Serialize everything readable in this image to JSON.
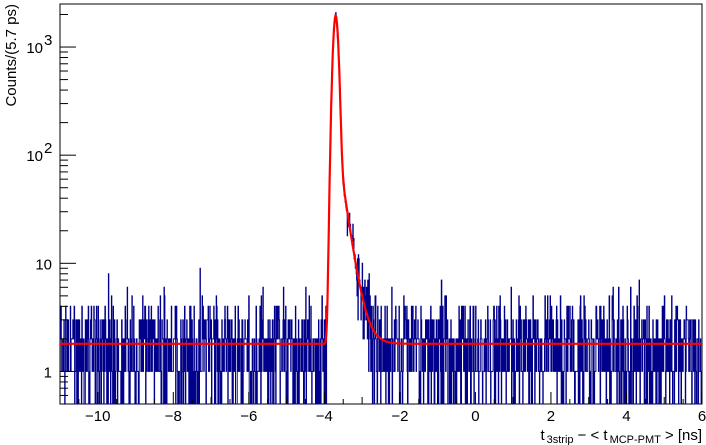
{
  "chart_data": {
    "type": "histogram",
    "scale": {
      "y": "log"
    },
    "xlim": [
      -11,
      6
    ],
    "ylim": [
      0.5,
      2500
    ],
    "ylabel": "Counts/(5.7 ps)",
    "xlabel": {
      "t": "t",
      "sub1": "3strip",
      "mid": "− < t",
      "sub2": "MCP-PMT",
      "end": "> [ns]"
    },
    "x_ticks": [
      "−10",
      "−8",
      "−6",
      "−4",
      "−2",
      "0",
      "2",
      "4",
      "6"
    ],
    "x_tick_values": [
      -10,
      -8,
      -6,
      -4,
      -2,
      0,
      2,
      4,
      6
    ],
    "y_ticks": [
      {
        "value": 1,
        "base": "1",
        "exp": ""
      },
      {
        "value": 10,
        "base": "10",
        "exp": ""
      },
      {
        "value": 100,
        "base": "10",
        "exp": "2"
      },
      {
        "value": 1000,
        "base": "10",
        "exp": "3"
      }
    ],
    "histogram": {
      "bin_width_ns": 0.0057,
      "background_level": 1.8,
      "background_range": [
        1,
        5
      ],
      "peak_center_ns": -3.7,
      "peak_height": 1900,
      "color": "#00008b"
    },
    "fit": {
      "color": "#ff0000",
      "baseline": 1.8,
      "peak_center_ns": -3.7,
      "peak_height": 1950,
      "sigma_ns": 0.06,
      "tail_decay_ns": 0.18
    },
    "grid": false,
    "legend": "none"
  }
}
